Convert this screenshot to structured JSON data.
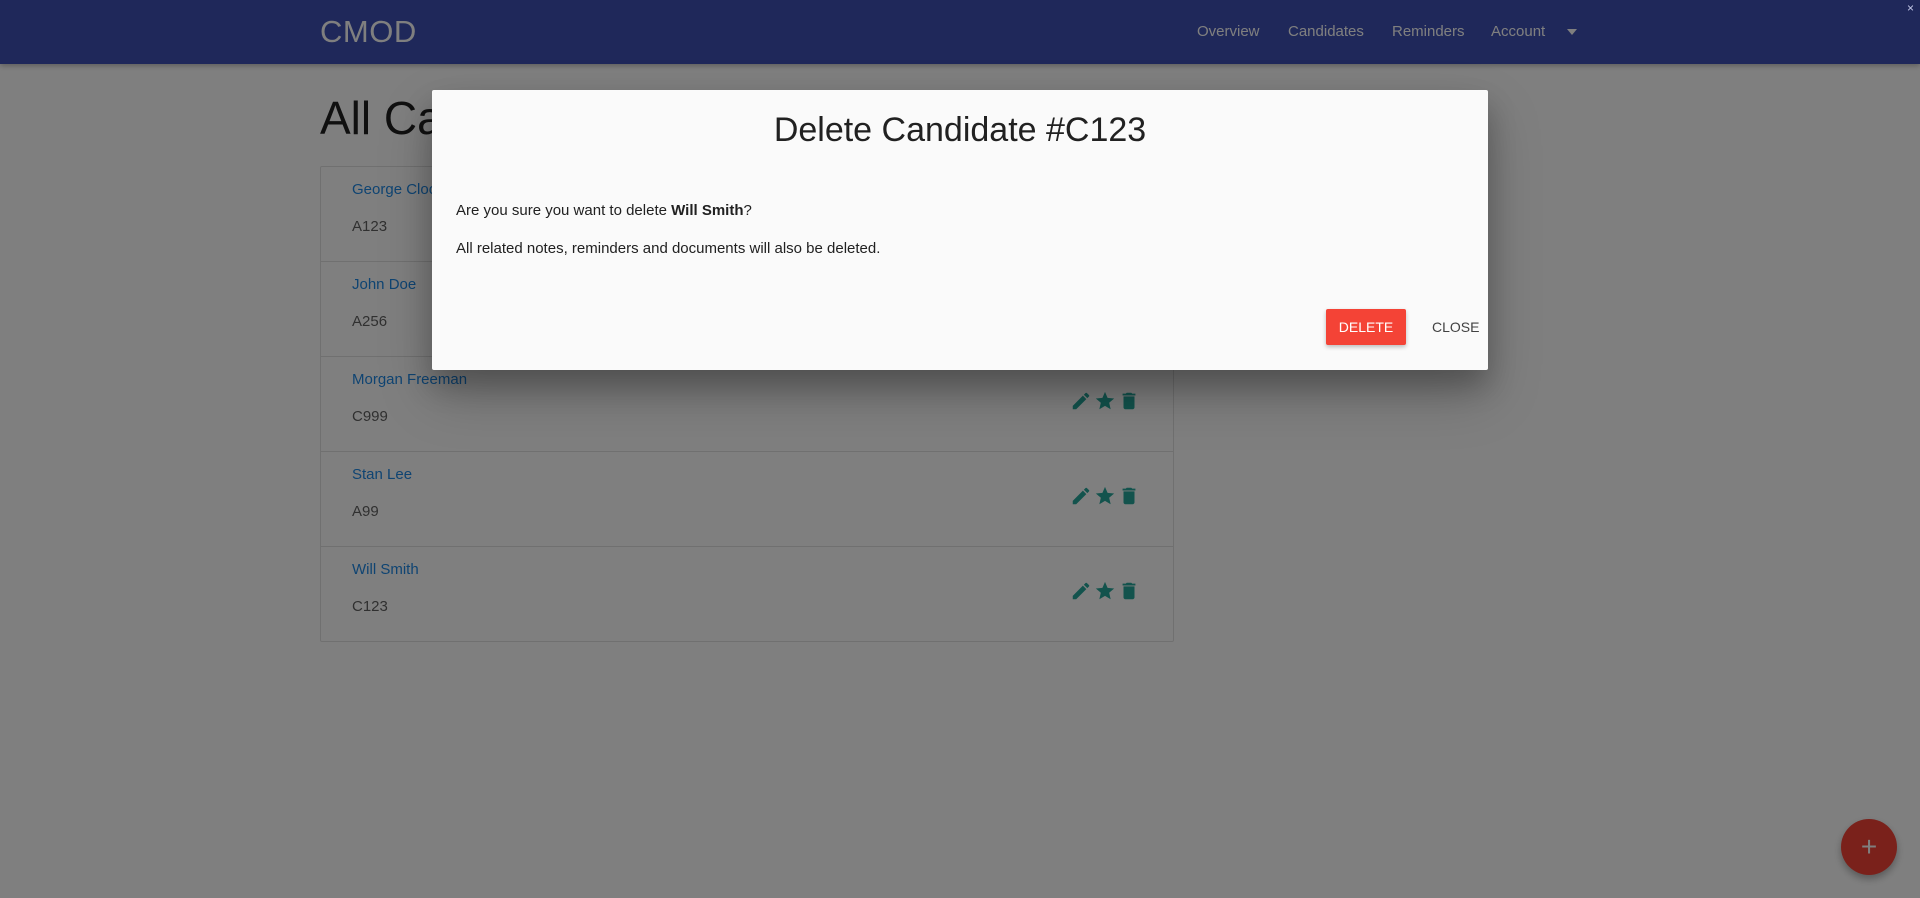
{
  "navbar": {
    "brand": "CMOD",
    "links": [
      "Overview",
      "Candidates",
      "Reminders",
      "Account"
    ],
    "color": "#3f51b5"
  },
  "page": {
    "title": "All Candidates"
  },
  "candidates": [
    {
      "name": "George Clooney",
      "code": "A123"
    },
    {
      "name": "John Doe",
      "code": "A256"
    },
    {
      "name": "Morgan Freeman",
      "code": "C999"
    },
    {
      "name": "Stan Lee",
      "code": "A99"
    },
    {
      "name": "Will Smith",
      "code": "C123"
    }
  ],
  "icons": {
    "edit": "pencil-icon",
    "favorite": "star-icon",
    "delete": "trash-icon",
    "fab": "plus-icon",
    "account_caret": "caret-down-icon"
  },
  "fab": {
    "label": "+",
    "color": "#f44336"
  },
  "modal": {
    "title": "Delete Candidate #C123",
    "question_prefix": "Are you sure you want to delete ",
    "question_name": "Will Smith",
    "question_suffix": "?",
    "note": "All related notes, reminders and documents will also be deleted.",
    "delete_label": "DELETE",
    "close_label": "CLOSE",
    "delete_color": "#f44336"
  },
  "colors": {
    "accent": "#26a69a",
    "link": "#1e88e5"
  }
}
